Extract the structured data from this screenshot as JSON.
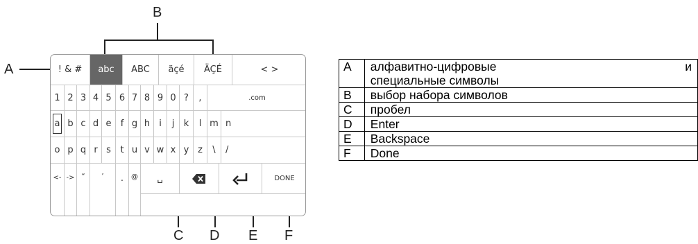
{
  "callouts": {
    "a": "A",
    "b": "B",
    "c": "C",
    "d": "D",
    "e": "E",
    "f": "F"
  },
  "keyboard": {
    "top_row": {
      "symbols": "! & #",
      "lower": "abc",
      "upper": "ABC",
      "accent_lower": "äçé",
      "accent_upper": "ÄÇÉ",
      "cursor": "< >"
    },
    "row1": [
      "1",
      "2",
      "3",
      "4",
      "5",
      "6",
      "7",
      "8",
      "9",
      "0",
      "?",
      ",",
      ".com"
    ],
    "row2": [
      "a",
      "b",
      "c",
      "d",
      "e",
      "f",
      "g",
      "h",
      "i",
      "j",
      "k",
      "l",
      "m",
      "n"
    ],
    "row3": [
      "o",
      "p",
      "q",
      "r",
      "s",
      "t",
      "u",
      "v",
      "w",
      "x",
      "y",
      "z",
      "\\",
      "/"
    ],
    "row4": {
      "left": "<-",
      "right": "->",
      "dquote": "“",
      "squote": "’",
      "dot": ".",
      "at": "@",
      "space": "␣",
      "done": "DONE"
    },
    "selected_set": "abc",
    "focused_key": "a"
  },
  "legend": [
    {
      "letter": "A",
      "desc_line1": "алфавитно-цифровые",
      "desc_right": "и",
      "desc_line2": "специальные символы"
    },
    {
      "letter": "B",
      "desc": "выбор набора символов"
    },
    {
      "letter": "C",
      "desc": "пробел"
    },
    {
      "letter": "D",
      "desc": "Enter"
    },
    {
      "letter": "E",
      "desc": "Backspace"
    },
    {
      "letter": "F",
      "desc": "Done"
    }
  ]
}
